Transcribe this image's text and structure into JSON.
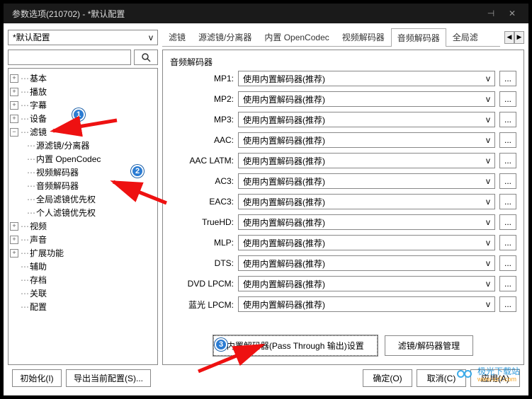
{
  "window": {
    "title": "参数选项(210702) - *默认配置"
  },
  "config_select": {
    "value": "*默认配置",
    "caret": "v"
  },
  "tabs": {
    "items": [
      {
        "label": "滤镜"
      },
      {
        "label": "源滤镜/分离器"
      },
      {
        "label": "内置 OpenCodec"
      },
      {
        "label": "视频解码器"
      },
      {
        "label": "音频解码器"
      },
      {
        "label": "全局滤"
      }
    ],
    "active_index": 4
  },
  "search": {
    "placeholder": ""
  },
  "tree": {
    "items": [
      {
        "label": "基本",
        "exp": "+"
      },
      {
        "label": "播放",
        "exp": "+"
      },
      {
        "label": "字幕",
        "exp": "+"
      },
      {
        "label": "设备",
        "exp": "+"
      },
      {
        "label": "滤镜",
        "exp": "−",
        "children": [
          {
            "label": "源滤镜/分离器"
          },
          {
            "label": "内置 OpenCodec"
          },
          {
            "label": "视频解码器"
          },
          {
            "label": "音频解码器"
          },
          {
            "label": "全局滤镜优先权"
          },
          {
            "label": "个人滤镜优先权"
          }
        ]
      },
      {
        "label": "视频",
        "exp": "+"
      },
      {
        "label": "声音",
        "exp": "+"
      },
      {
        "label": "扩展功能",
        "exp": "+"
      },
      {
        "label": "辅助"
      },
      {
        "label": "存档"
      },
      {
        "label": "关联"
      },
      {
        "label": "配置"
      }
    ]
  },
  "panel": {
    "title": "音频解码器",
    "decoders": [
      {
        "label": "MP1:",
        "value": "使用内置解码器(推荐)"
      },
      {
        "label": "MP2:",
        "value": "使用内置解码器(推荐)"
      },
      {
        "label": "MP3:",
        "value": "使用内置解码器(推荐)"
      },
      {
        "label": "AAC:",
        "value": "使用内置解码器(推荐)"
      },
      {
        "label": "AAC LATM:",
        "value": "使用内置解码器(推荐)"
      },
      {
        "label": "AC3:",
        "value": "使用内置解码器(推荐)"
      },
      {
        "label": "EAC3:",
        "value": "使用内置解码器(推荐)"
      },
      {
        "label": "TrueHD:",
        "value": "使用内置解码器(推荐)"
      },
      {
        "label": "MLP:",
        "value": "使用内置解码器(推荐)"
      },
      {
        "label": "DTS:",
        "value": "使用内置解码器(推荐)"
      },
      {
        "label": "DVD LPCM:",
        "value": "使用内置解码器(推荐)"
      },
      {
        "label": "蓝光 LPCM:",
        "value": "使用内置解码器(推荐)"
      }
    ],
    "caret": "v",
    "more": "...",
    "btn_passthrough": "内置解码器(Pass Through 输出)设置",
    "btn_manage": "滤镜/解码器管理"
  },
  "footer": {
    "init": "初始化(I)",
    "export": "导出当前配置(S)...",
    "ok": "确定(O)",
    "cancel": "取消(C)",
    "apply": "应用(A)"
  },
  "annotations": {
    "b1": "1",
    "b2": "2",
    "b3": "3"
  },
  "watermark": {
    "name": "极光下载站",
    "url": "www.xz7.com"
  }
}
